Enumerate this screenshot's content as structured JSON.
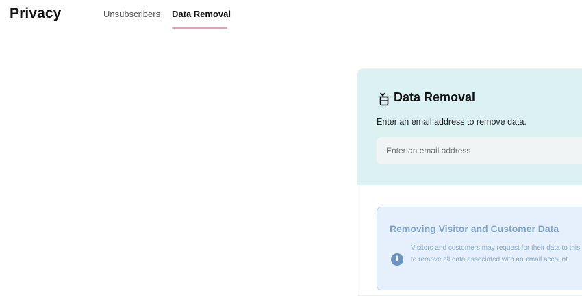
{
  "header": {
    "title": "Privacy",
    "tabs": [
      {
        "label": "Unsubscribers",
        "active": false
      },
      {
        "label": "Data Removal",
        "active": true
      }
    ],
    "active_tab_color": "#e8a0ae"
  },
  "card": {
    "icon": "trash-icon",
    "title": "Data Removal",
    "subtitle": "Enter an email address to remove data.",
    "email_input": {
      "value": "",
      "placeholder": "Enter an email address"
    },
    "header_bg": "#dcf2f2"
  },
  "info": {
    "icon": "info-icon",
    "title": "Removing Visitor and Customer Data",
    "text": "Visitors and customers may request for their data to this tool to remove all data associated with an email account.",
    "bg": "#e5f0fc",
    "accent": "#6f93bf"
  }
}
